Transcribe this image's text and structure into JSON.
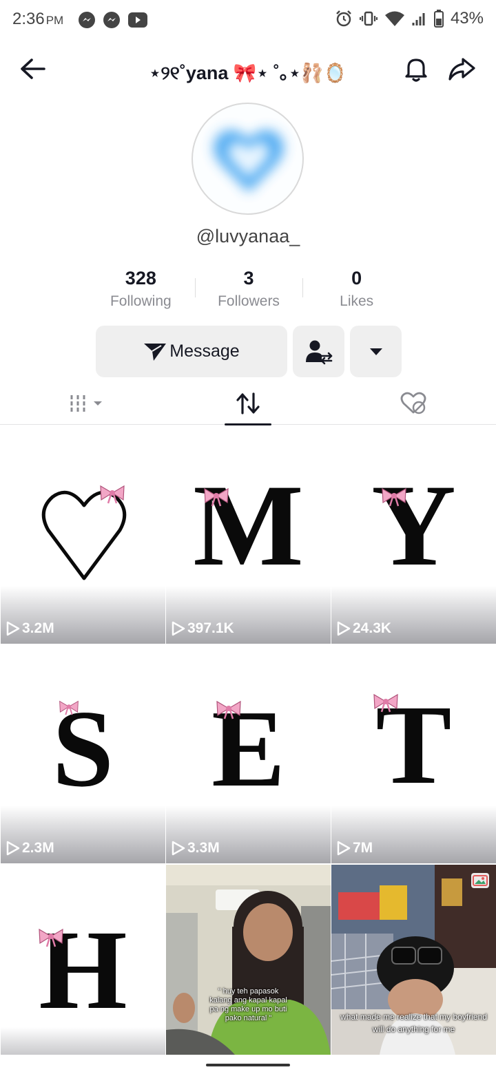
{
  "status_bar": {
    "time": "2:36",
    "ampm": "PM",
    "battery": "43%",
    "notification_icons": [
      "messenger-icon",
      "messenger-icon",
      "youtube-icon"
    ],
    "system_icons": [
      "alarm-icon",
      "vibrate-icon",
      "wifi-icon",
      "signal-icon",
      "battery-icon"
    ]
  },
  "header": {
    "title": "⋆୨୧˚yana 🎀⋆ ˚｡⋆🩰🪞"
  },
  "profile": {
    "handle": "@luvyanaa_",
    "avatar": "blue-heart-avatar"
  },
  "stats": [
    {
      "value": "328",
      "label": "Following"
    },
    {
      "value": "3",
      "label": "Followers"
    },
    {
      "value": "0",
      "label": "Likes"
    }
  ],
  "actions": {
    "message_label": "Message"
  },
  "videos": [
    {
      "glyph": "♡",
      "views": "3.2M"
    },
    {
      "glyph": "M",
      "views": "397.1K"
    },
    {
      "glyph": "Y",
      "views": "24.3K"
    },
    {
      "glyph": "S",
      "views": "2.3M"
    },
    {
      "glyph": "E",
      "views": "3.3M"
    },
    {
      "glyph": "T",
      "views": "7M"
    },
    {
      "glyph": "H",
      "views": ""
    },
    {
      "glyph": "",
      "views": "",
      "caption": "\" huy teh papasok kalang ang kapal kapal pa ng make up mo buti pako natural \""
    },
    {
      "glyph": "",
      "views": "",
      "caption": "what made me realize that my boyfriend will do anything for me"
    }
  ],
  "colors": {
    "text": "#161823",
    "muted": "#8a8b91",
    "button_bg": "#efefef",
    "bow": "#f2a6c6",
    "avatar_heart": "#3aa0f0"
  }
}
